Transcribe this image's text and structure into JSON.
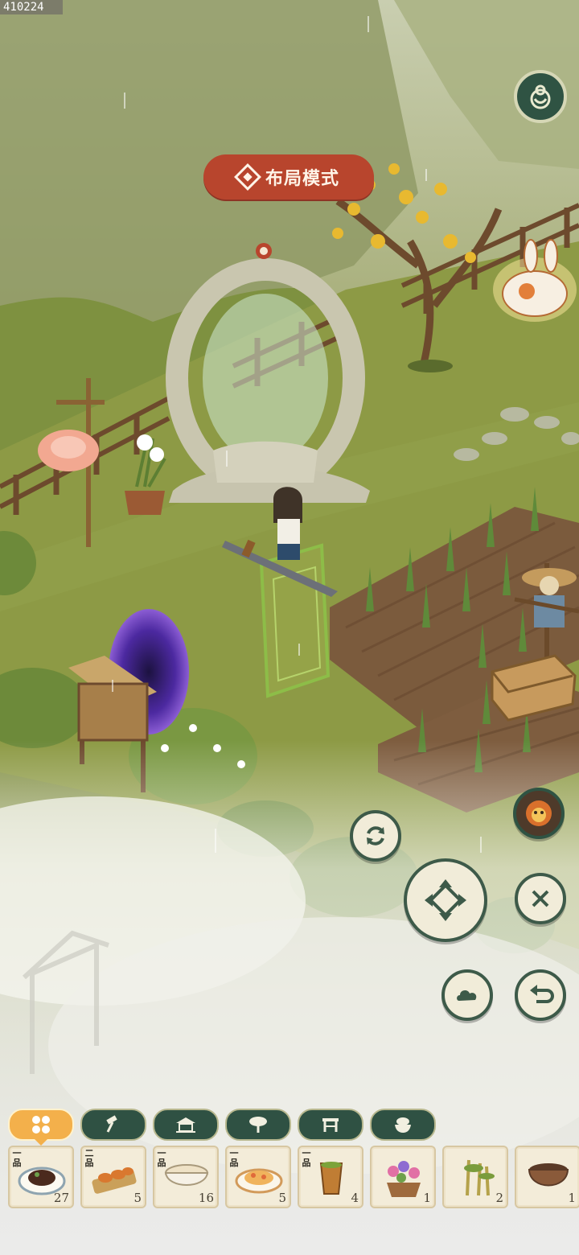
{
  "top_id": "410224",
  "layout_mode_label": "布局模式",
  "category_tabs": [
    {
      "icon": "grid-icon"
    },
    {
      "icon": "hammer-icon"
    },
    {
      "icon": "pavilion-icon"
    },
    {
      "icon": "tree-icon"
    },
    {
      "icon": "table-icon"
    },
    {
      "icon": "bowl-icon"
    }
  ],
  "items": [
    {
      "grade": "一品",
      "count": "27",
      "icon": "dish-plate-icon"
    },
    {
      "grade": "二品",
      "count": "5",
      "icon": "skewer-plate-icon"
    },
    {
      "grade": "一品",
      "count": "16",
      "icon": "soup-bowl-icon"
    },
    {
      "grade": "一品",
      "count": "5",
      "icon": "noodle-plate-icon"
    },
    {
      "grade": "一品",
      "count": "4",
      "icon": "tea-cup-icon"
    },
    {
      "grade": "",
      "count": "1",
      "icon": "flower-pot-icon"
    },
    {
      "grade": "",
      "count": "2",
      "icon": "bamboo-icon"
    },
    {
      "grade": "",
      "count": "1",
      "icon": "clay-bowl-icon"
    }
  ],
  "colors": {
    "accent": "#b8452d",
    "panel": "#2f5143",
    "button_light": "#f1ecd9",
    "active_tab": "#f3b04b"
  }
}
